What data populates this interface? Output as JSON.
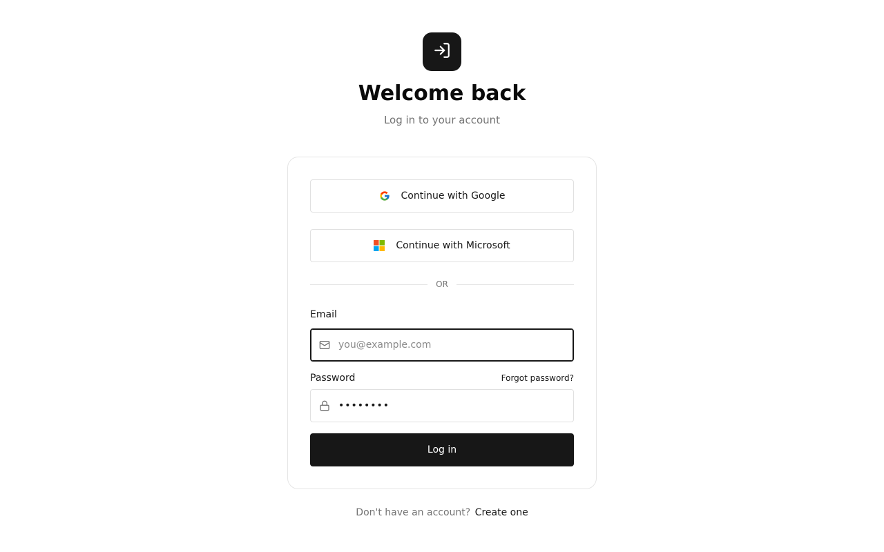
{
  "header": {
    "logo_icon": "log-in-icon",
    "title": "Welcome back",
    "subtitle": "Log in to your account"
  },
  "sso": {
    "google_label": "Continue with Google",
    "google_icon": "google-logo-icon",
    "microsoft_label": "Continue with Microsoft",
    "microsoft_icon": "microsoft-logo-icon"
  },
  "divider": {
    "text": "OR"
  },
  "form": {
    "email": {
      "label": "Email",
      "placeholder": "you@example.com",
      "value": "",
      "icon": "mail-icon",
      "focused": true
    },
    "password": {
      "label": "Password",
      "value": "••••••••",
      "icon": "lock-icon",
      "forgot_label": "Forgot password?"
    },
    "submit_label": "Log in"
  },
  "footer": {
    "prompt": "Don't have an account?",
    "link_label": "Create one"
  },
  "colors": {
    "primary": "#171717",
    "muted_text": "#737373",
    "border": "#e5e5e5",
    "microsoft_red": "#f25022",
    "microsoft_green": "#7fba00",
    "microsoft_blue": "#00a4ef",
    "microsoft_yellow": "#ffb900"
  }
}
